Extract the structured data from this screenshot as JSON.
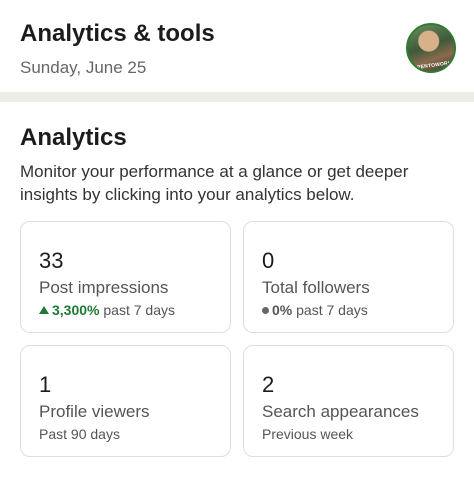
{
  "header": {
    "title": "Analytics & tools",
    "date": "Sunday, June 25"
  },
  "avatar": {
    "badge_text": "#OPENTOWORK",
    "badge_color": "#2e7d32"
  },
  "analytics": {
    "title": "Analytics",
    "description": "Monitor your performance at a glance or get deeper insights by clicking into your analytics below.",
    "cards": [
      {
        "value": "33",
        "label": "Post impressions",
        "trend": "up",
        "change": "3,300%",
        "period": "past 7 days"
      },
      {
        "value": "0",
        "label": "Total followers",
        "trend": "neutral",
        "change": "0%",
        "period": "past 7 days"
      },
      {
        "value": "1",
        "label": "Profile viewers",
        "period": "Past 90 days"
      },
      {
        "value": "2",
        "label": "Search appearances",
        "period": "Previous week"
      }
    ]
  },
  "colors": {
    "positive": "#1e7a34",
    "divider": "#eeece6"
  }
}
